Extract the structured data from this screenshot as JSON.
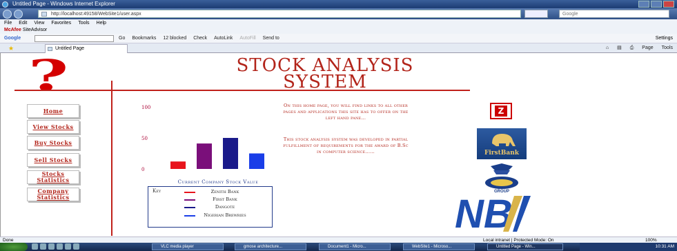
{
  "window": {
    "title": "Untitled Page - Windows Internet Explorer",
    "url": "http://localhost:49158/WebSite1/user.aspx",
    "search_placeholder": "Google"
  },
  "menubar": [
    "File",
    "Edit",
    "View",
    "Favorites",
    "Tools",
    "Help"
  ],
  "mcafee": {
    "brand": "McAfee",
    "label": "SiteAdvisor"
  },
  "googlebar": {
    "logo": "Google",
    "go": "Go",
    "bookmarks": "Bookmarks",
    "blocked": "12 blocked",
    "check": "Check",
    "autolink": "AutoLink",
    "autofill": "AutoFill",
    "sendto": "Send to",
    "settings": "Settings"
  },
  "tab": {
    "label": "Untitled Page"
  },
  "commandbar": {
    "page": "Page",
    "tools": "Tools"
  },
  "site": {
    "logo_glyph": "?",
    "title_line1": "STOCK ANALYSIS",
    "title_line2": "SYSTEM"
  },
  "nav": [
    {
      "label": "Home"
    },
    {
      "label": "View Stocks"
    },
    {
      "label": "Buy Stocks"
    },
    {
      "label": "Sell Stocks"
    },
    {
      "label": "Stocks Statistics"
    },
    {
      "label": "Company Statistics"
    }
  ],
  "info": {
    "paragraph1": "On this home page, you will find links to all other pages and applications this site has to offer on the left hand pane...",
    "paragraph2": "This stock analysis system was developed in partial fulfillment of requirements for the award of B.Sc in computer science......"
  },
  "chart_data": {
    "type": "bar",
    "title": "Current Company Stock Value",
    "yticks": [
      "100",
      "50",
      "0"
    ],
    "ylim": [
      0,
      100
    ],
    "categories": [
      "Zenith Bank",
      "First Bank",
      "Dangote",
      "Nigerian Brewries"
    ],
    "values": [
      12,
      41,
      50,
      25
    ],
    "colors": [
      "#e8141c",
      "#7a0f7a",
      "#1a1a8a",
      "#1a3ee8"
    ],
    "legend_title": "Key"
  },
  "logos": {
    "zenith": "Z",
    "firstbank": "FirstBank",
    "dangote": "GROUP",
    "nb": "NB"
  },
  "statusbar": {
    "left": "Done",
    "zone": "Local intranet | Protected Mode: On",
    "zoom": "100%"
  },
  "taskbar": {
    "items": [
      "VLC media player",
      "gmose architecture...",
      "Document1 - Micro...",
      "WebSite1 - Microso...",
      "Untitled Page - Win..."
    ],
    "clock": "10:31 AM"
  }
}
